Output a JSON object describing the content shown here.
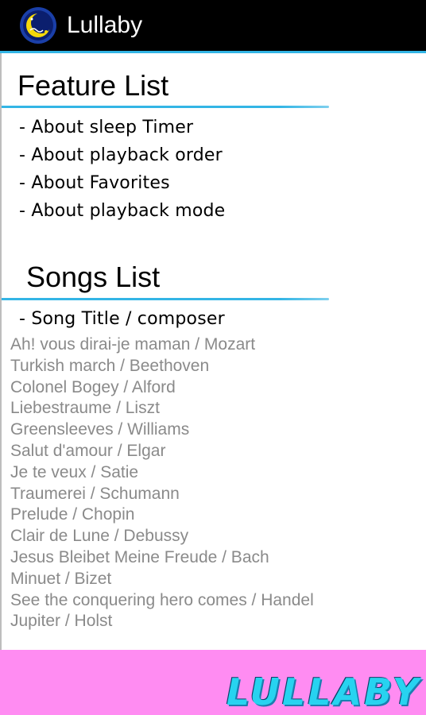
{
  "appbar": {
    "title": "Lullaby",
    "icon": "moon-music-icon"
  },
  "feature_section": {
    "heading": "Feature List",
    "items": [
      "- About sleep Timer",
      "- About playback order",
      "- About Favorites",
      "- About playback mode"
    ]
  },
  "songs_section": {
    "heading": "Songs List",
    "subheading": "- Song Title / composer",
    "songs": [
      "Ah! vous dirai-je maman / Mozart",
      "Turkish march / Beethoven",
      "Colonel Bogey / Alford",
      "Liebestraume / Liszt",
      "Greensleeves / Williams",
      "Salut d'amour / Elgar",
      "Je te veux / Satie",
      "Traumerei / Schumann",
      "Prelude / Chopin",
      "Clair de Lune / Debussy",
      "Jesus Bleibet Meine Freude / Bach",
      "Minuet / Bizet",
      "See the conquering hero comes / Handel",
      "Jupiter / Holst"
    ]
  },
  "footer": {
    "logo_text": "LULLABY"
  },
  "colors": {
    "accent": "#33b5e5",
    "footer_bg": "#ff8cf2",
    "logo": "#27d3f0",
    "song_text": "#8a8a8a"
  }
}
